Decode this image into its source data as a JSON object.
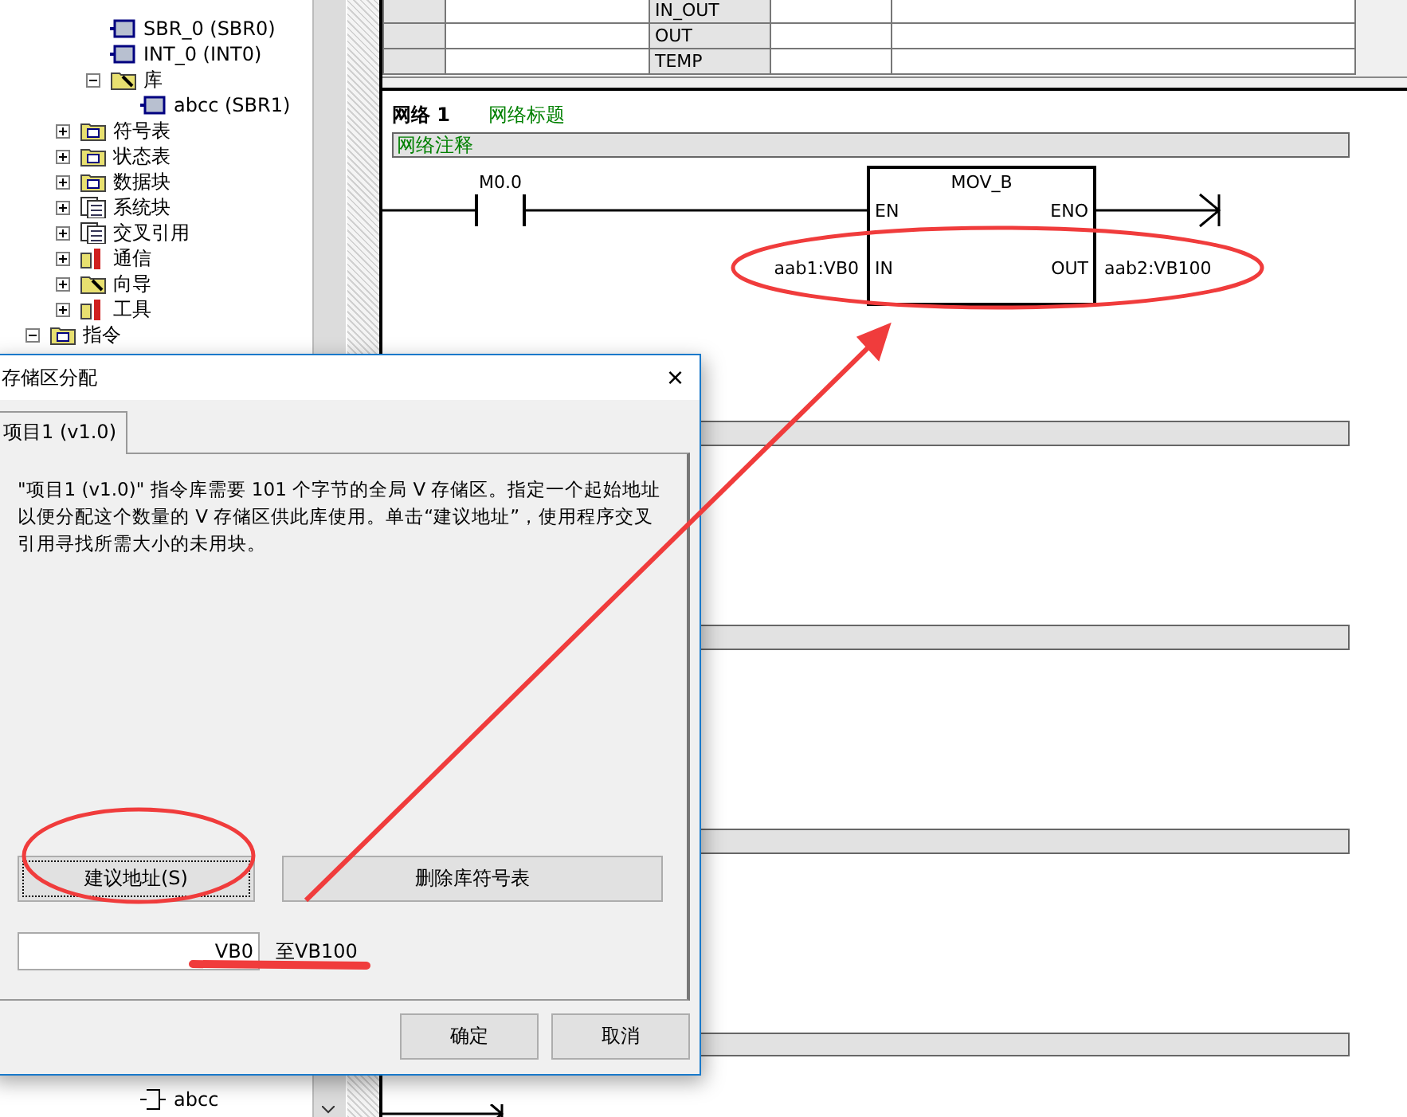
{
  "tree": {
    "program_blocks": [
      {
        "label": "SBR_0 (SBR0)",
        "kind": "block"
      },
      {
        "label": "INT_0 (INT0)",
        "kind": "block"
      },
      {
        "label": "库",
        "kind": "library",
        "expanded": true,
        "children": [
          {
            "label": "abcc (SBR1)",
            "kind": "block"
          }
        ]
      }
    ],
    "project_items": [
      {
        "label": "符号表",
        "kind": "folder",
        "expanded": false
      },
      {
        "label": "状态表",
        "kind": "folder",
        "expanded": false
      },
      {
        "label": "数据块",
        "kind": "folder",
        "expanded": false
      },
      {
        "label": "系统块",
        "kind": "document",
        "expanded": false
      },
      {
        "label": "交叉引用",
        "kind": "document",
        "expanded": false
      },
      {
        "label": "通信",
        "kind": "tools",
        "expanded": false
      },
      {
        "label": "向导",
        "kind": "library",
        "expanded": false
      },
      {
        "label": "工具",
        "kind": "tools",
        "expanded": false
      }
    ],
    "root_items": [
      {
        "label": "指令",
        "kind": "folder",
        "expanded": true
      }
    ],
    "bottom_items": [
      {
        "label": "abcc",
        "kind": "instruction"
      }
    ]
  },
  "variable_table": {
    "rows": [
      {
        "type": "IN_OUT"
      },
      {
        "type": "OUT"
      },
      {
        "type": "TEMP"
      }
    ]
  },
  "networks": [
    {
      "kind": "ladder",
      "title": "网络 1",
      "heading": "网络标题",
      "comment": "网络注释",
      "contact": "M0.0",
      "box": {
        "name": "MOV_B",
        "en": "EN",
        "eno": "ENO",
        "in": "IN",
        "out": "OUT",
        "in_operand": "aab1:VB0",
        "out_operand": "aab2:VB100"
      }
    },
    {
      "kind": "empty"
    },
    {
      "kind": "empty"
    },
    {
      "kind": "empty"
    },
    {
      "kind": "rung"
    }
  ],
  "dialog": {
    "title": "存储区分配",
    "close": "×",
    "tabs": [
      {
        "label": "项目1 (v1.0)",
        "selected": true
      }
    ],
    "message": "\"项目1 (v1.0)\" 指令库需要 101 个字节的全局 V 存储区。指定一个起始地址以便分配这个数量的 V 存储区供此库使用。单击“建议地址”，使用程序交叉引用寻找所需大小的未用块。",
    "actions": [
      {
        "label": "建议地址(S)",
        "focused": true
      },
      {
        "label": "删除库符号表",
        "focused": false
      }
    ],
    "start_address": "VB0",
    "end_address": "至VB100",
    "buttons": [
      {
        "label": "确定",
        "focused": false
      },
      {
        "label": "取消",
        "focused": false
      }
    ]
  }
}
